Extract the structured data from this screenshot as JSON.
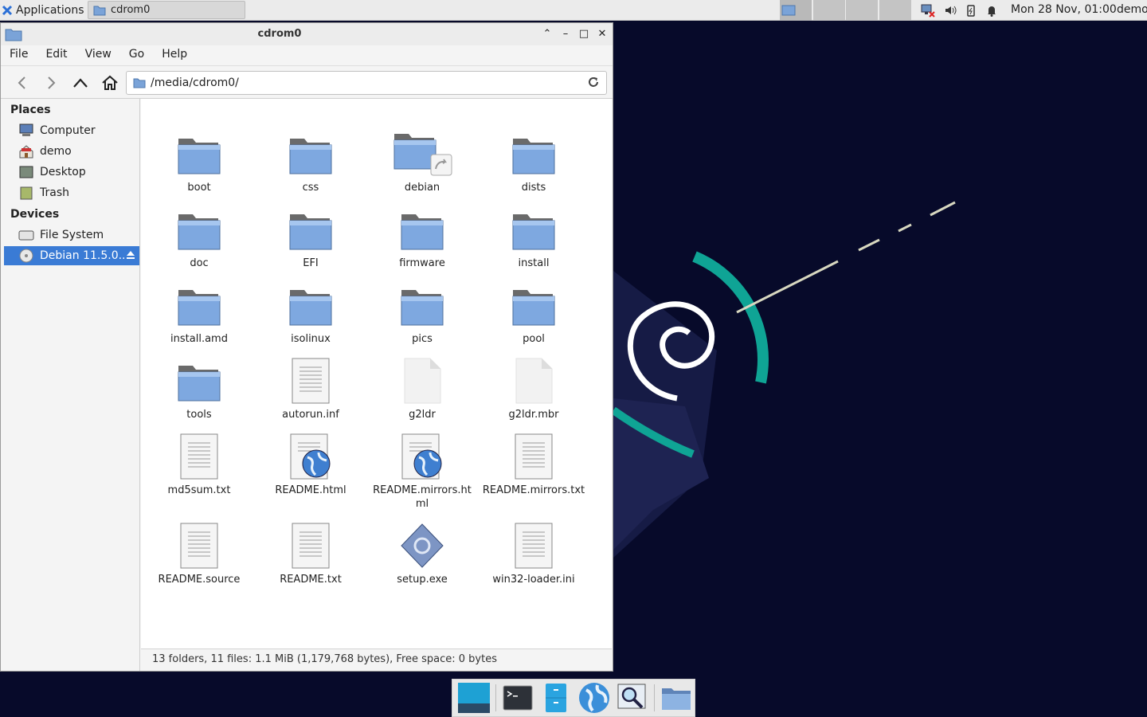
{
  "panel": {
    "apps_label": "Applications",
    "task_title": "cdrom0",
    "clock": "Mon 28 Nov, 01:00",
    "user": "demo"
  },
  "window": {
    "title": "cdrom0",
    "menu": [
      "File",
      "Edit",
      "View",
      "Go",
      "Help"
    ],
    "path": "/media/cdrom0/"
  },
  "sidebar": {
    "places_header": "Places",
    "places": [
      {
        "label": "Computer",
        "icon": "computer-icon"
      },
      {
        "label": "demo",
        "icon": "home-icon"
      },
      {
        "label": "Desktop",
        "icon": "desktop-icon"
      },
      {
        "label": "Trash",
        "icon": "trash-icon"
      }
    ],
    "devices_header": "Devices",
    "devices": [
      {
        "label": "File System",
        "icon": "drive-icon"
      },
      {
        "label": "Debian 11.5.0...",
        "icon": "disc-icon",
        "selected": true
      }
    ]
  },
  "files": [
    {
      "name": "boot",
      "type": "folder"
    },
    {
      "name": "css",
      "type": "folder"
    },
    {
      "name": "debian",
      "type": "folder-link"
    },
    {
      "name": "dists",
      "type": "folder"
    },
    {
      "name": "doc",
      "type": "folder"
    },
    {
      "name": "EFI",
      "type": "folder"
    },
    {
      "name": "firmware",
      "type": "folder"
    },
    {
      "name": "install",
      "type": "folder"
    },
    {
      "name": "install.amd",
      "type": "folder"
    },
    {
      "name": "isolinux",
      "type": "folder"
    },
    {
      "name": "pics",
      "type": "folder"
    },
    {
      "name": "pool",
      "type": "folder"
    },
    {
      "name": "tools",
      "type": "folder"
    },
    {
      "name": "autorun.inf",
      "type": "text"
    },
    {
      "name": "g2ldr",
      "type": "blank"
    },
    {
      "name": "g2ldr.mbr",
      "type": "blank"
    },
    {
      "name": "md5sum.txt",
      "type": "text"
    },
    {
      "name": "README.html",
      "type": "html"
    },
    {
      "name": "README.mirrors.html",
      "type": "html"
    },
    {
      "name": "README.mirrors.txt",
      "type": "text"
    },
    {
      "name": "README.source",
      "type": "text"
    },
    {
      "name": "README.txt",
      "type": "text"
    },
    {
      "name": "setup.exe",
      "type": "exe"
    },
    {
      "name": "win32-loader.ini",
      "type": "text"
    }
  ],
  "status": "13 folders, 11 files: 1.1 MiB (1,179,768 bytes), Free space: 0 bytes",
  "dock": [
    "show-desktop-icon",
    "terminal-icon",
    "file-manager-icon",
    "web-browser-icon",
    "app-finder-icon",
    "folder-icon"
  ],
  "colors": {
    "accent": "#3a7bd5",
    "desktop": "#070a2a",
    "swirl": "#0fa495"
  }
}
